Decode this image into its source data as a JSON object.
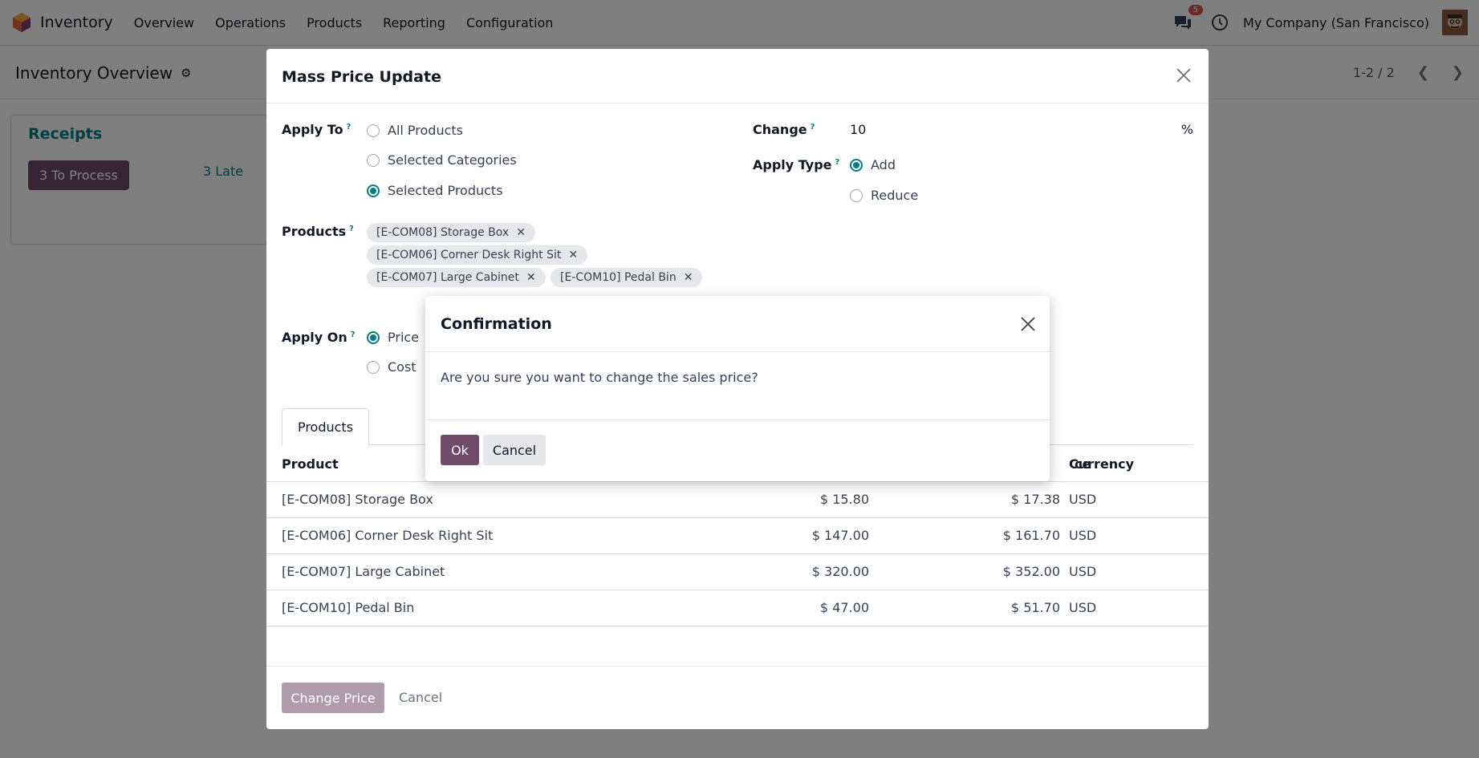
{
  "navbar": {
    "app_name": "Inventory",
    "menus": [
      "Overview",
      "Operations",
      "Products",
      "Reporting",
      "Configuration"
    ],
    "chat_badge": "5",
    "company": "My Company (San Francisco)"
  },
  "control": {
    "title": "Inventory Overview",
    "pager": "1-2 / 2"
  },
  "receipts": {
    "title": "Receipts",
    "to_process": "3 To Process",
    "late": "3 Late"
  },
  "modal": {
    "title": "Mass Price Update",
    "apply_to": {
      "label": "Apply To",
      "options": [
        "All Products",
        "Selected Categories",
        "Selected Products"
      ],
      "selected": "Selected Products"
    },
    "products_field": {
      "label": "Products",
      "tags": [
        "[E-COM08] Storage Box",
        "[E-COM06] Corner Desk Right Sit",
        "[E-COM07] Large Cabinet",
        "[E-COM10] Pedal Bin"
      ]
    },
    "apply_on": {
      "label": "Apply On",
      "options": [
        "Price",
        "Cost"
      ],
      "selected": "Price"
    },
    "change": {
      "label": "Change",
      "value": "10",
      "unit": "%"
    },
    "apply_type": {
      "label": "Apply Type",
      "options": [
        "Add",
        "Reduce"
      ],
      "selected": "Add"
    },
    "tab": "Products",
    "table": {
      "headers": [
        "Product",
        "ce",
        "Currency"
      ],
      "rows": [
        {
          "product": "[E-COM08] Storage Box",
          "old": "$ 15.80",
          "new": "$ 17.38",
          "currency": "USD"
        },
        {
          "product": "[E-COM06] Corner Desk Right Sit",
          "old": "$ 147.00",
          "new": "$ 161.70",
          "currency": "USD"
        },
        {
          "product": "[E-COM07] Large Cabinet",
          "old": "$ 320.00",
          "new": "$ 352.00",
          "currency": "USD"
        },
        {
          "product": "[E-COM10] Pedal Bin",
          "old": "$ 47.00",
          "new": "$ 51.70",
          "currency": "USD"
        }
      ]
    },
    "footer": {
      "primary": "Change Price",
      "secondary": "Cancel"
    }
  },
  "confirm": {
    "title": "Confirmation",
    "message": "Are you sure you want to change the sales price?",
    "ok": "Ok",
    "cancel": "Cancel"
  },
  "colors": {
    "brand": "#714b67",
    "accent": "#017e84",
    "badge": "#d9534f"
  }
}
